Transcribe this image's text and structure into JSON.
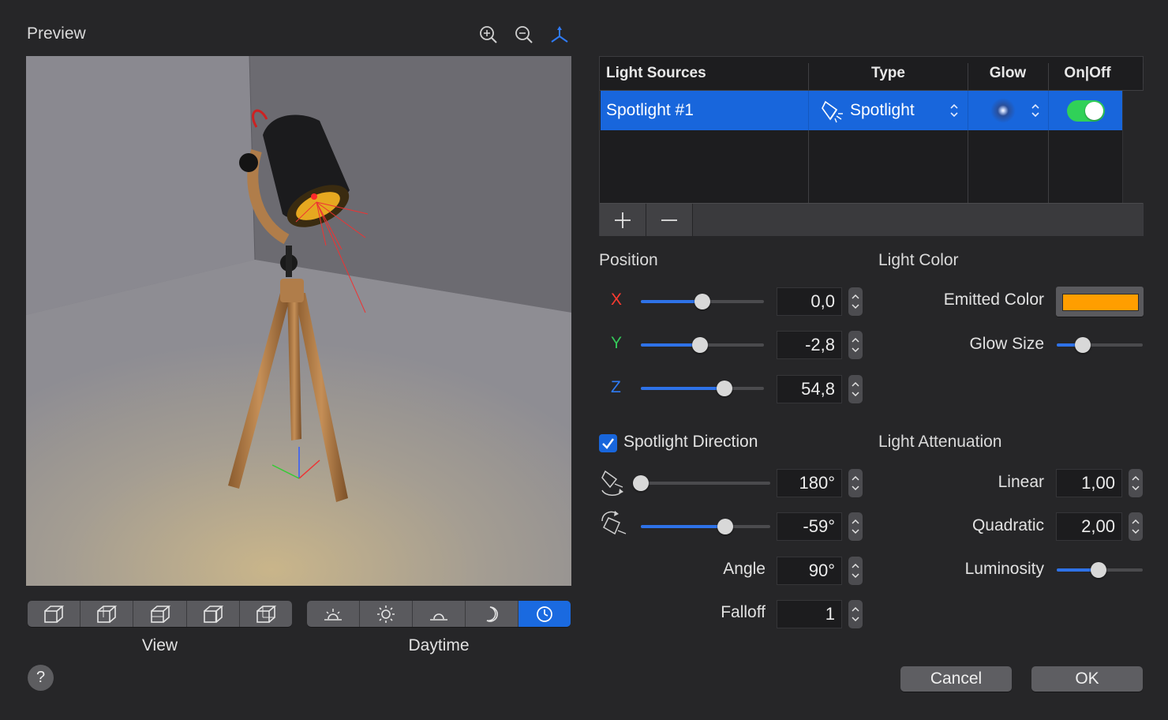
{
  "preview": {
    "title": "Preview"
  },
  "view_label": "View",
  "daytime_label": "Daytime",
  "table": {
    "headers": {
      "sources": "Light Sources",
      "type": "Type",
      "glow": "Glow",
      "onoff": "On|Off"
    },
    "rows": [
      {
        "name": "Spotlight #1",
        "type": "Spotlight",
        "enabled": true
      }
    ]
  },
  "position": {
    "title": "Position",
    "x": {
      "label": "X",
      "value": "0,0",
      "fraction": 0.5
    },
    "y": {
      "label": "Y",
      "value": "-2,8",
      "fraction": 0.48
    },
    "z": {
      "label": "Z",
      "value": "54,8",
      "fraction": 0.68
    }
  },
  "light_color": {
    "title": "Light Color",
    "emitted_label": "Emitted Color",
    "emitted_hex": "#ff9e00",
    "glow_size_label": "Glow Size",
    "glow_size_fraction": 0.3
  },
  "spotlight": {
    "checkbox_label": "Spotlight Direction",
    "checked": true,
    "rotation_h": {
      "value": "180°",
      "fraction": 0.0
    },
    "rotation_v": {
      "value": "-59°",
      "fraction": 0.65
    },
    "angle_label": "Angle",
    "angle_value": "90°",
    "falloff_label": "Falloff",
    "falloff_value": "1"
  },
  "attenuation": {
    "title": "Light Attenuation",
    "linear_label": "Linear",
    "linear_value": "1,00",
    "quadratic_label": "Quadratic",
    "quadratic_value": "2,00",
    "luminosity_label": "Luminosity",
    "luminosity_fraction": 0.49
  },
  "buttons": {
    "cancel": "Cancel",
    "ok": "OK",
    "help": "?"
  },
  "colors": {
    "accent": "#1866dc",
    "toggle_on": "#30d158",
    "x_axis": "#ff3b30",
    "y_axis": "#34c759",
    "z_axis": "#2f7bf6"
  }
}
